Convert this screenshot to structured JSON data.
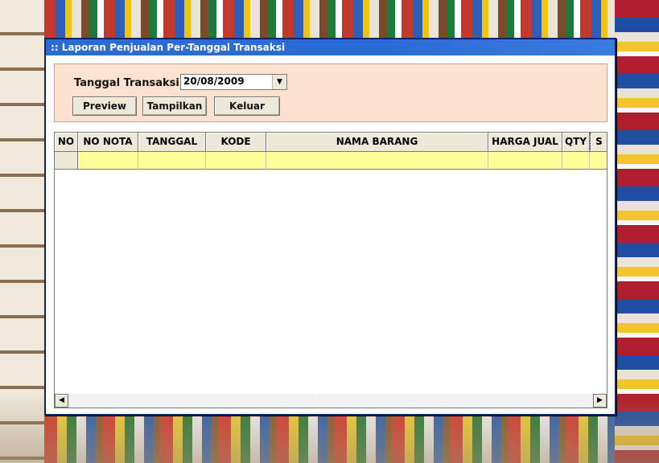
{
  "window": {
    "title": ":: Laporan Penjualan Per-Tanggal Transaksi"
  },
  "filter": {
    "label": "Tanggal Transaksi",
    "date_value": "20/08/2009",
    "dropdown_icon": "chevron-down-icon"
  },
  "buttons": {
    "preview": "Preview",
    "tampilkan": "Tampilkan",
    "keluar": "Keluar"
  },
  "grid": {
    "columns": [
      "NO",
      "NO NOTA",
      "TANGGAL",
      "KODE",
      "NAMA BARANG",
      "HARGA JUAL",
      "QTY",
      "S"
    ],
    "rows": [
      [
        "",
        "",
        "",
        "",
        "",
        "",
        "",
        ""
      ]
    ],
    "row_highlight_color": "#ffff99"
  },
  "colors": {
    "titlebar": "#2c6bd6",
    "panel": "#fde3cf",
    "window_border": "#0a246a"
  }
}
